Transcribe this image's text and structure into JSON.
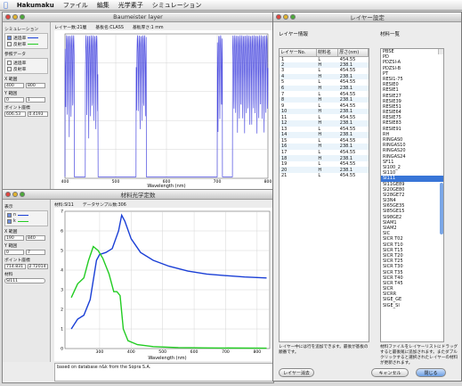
{
  "menubar": {
    "app": "Hakumaku",
    "items": [
      "ファイル",
      "編集",
      "光学素子",
      "シミュレーション"
    ]
  },
  "window1": {
    "title": "Baumeister layer",
    "info": [
      "レイヤー数:21層",
      "基板名:CLASS",
      "基板厚さ:1 mm"
    ],
    "side": {
      "sim_label": "シミュレーション",
      "sim_opts": [
        "透過率",
        "反射率"
      ],
      "ref_label": "参照データ",
      "ref_opts": [
        "透過率",
        "反射率"
      ],
      "x_label": "X 範囲",
      "x_vals": [
        "400",
        "800"
      ],
      "y_label": "Y 範囲",
      "y_vals": [
        "0",
        "1"
      ],
      "pt_label": "ポイント座標",
      "pt_vals": [
        "606.53",
        "0.4193"
      ]
    },
    "xlabel": "Wavelength (nm)",
    "xticks": [
      "400",
      "500",
      "600",
      "700",
      "800"
    ]
  },
  "window2": {
    "title": "材料光学定数",
    "info": [
      "材料:SI11",
      "データサンプル数:306"
    ],
    "side": {
      "disp_label": "表示",
      "disp_opts": [
        "n",
        "k"
      ],
      "x_label": "X 範囲",
      "x_vals": [
        "190",
        "840"
      ],
      "y_label": "Y 範囲",
      "y_vals": [
        "0",
        "7"
      ],
      "pt_label": "ポイント座標",
      "pt_vals": [
        "714.831",
        "2.72014"
      ],
      "mat_label": "材料",
      "mat_value": "SI111"
    },
    "xlabel": "Wavelength (nm)",
    "xticks": [
      "300",
      "400",
      "500",
      "600",
      "700",
      "800"
    ],
    "yticks": [
      "0",
      "1",
      "2",
      "3",
      "4",
      "5",
      "6",
      "7"
    ],
    "footer": "based on database n&k from the Sopra S.A."
  },
  "dialog": {
    "title": "レイヤー設定",
    "layer_info": "レイヤー情報",
    "materials_title": "材料一覧",
    "columns": [
      "レイヤーNo.",
      "材料名",
      "厚さ(nm)"
    ],
    "rows": [
      [
        "1",
        "L",
        "454.55"
      ],
      [
        "2",
        "H",
        "238.1"
      ],
      [
        "3",
        "L",
        "454.55"
      ],
      [
        "4",
        "H",
        "238.1"
      ],
      [
        "5",
        "L",
        "454.55"
      ],
      [
        "6",
        "H",
        "238.1"
      ],
      [
        "7",
        "L",
        "454.55"
      ],
      [
        "8",
        "H",
        "238.1"
      ],
      [
        "9",
        "L",
        "454.55"
      ],
      [
        "10",
        "H",
        "238.1"
      ],
      [
        "11",
        "L",
        "454.55"
      ],
      [
        "12",
        "H",
        "238.1"
      ],
      [
        "13",
        "L",
        "454.55"
      ],
      [
        "14",
        "H",
        "238.1"
      ],
      [
        "15",
        "L",
        "454.55"
      ],
      [
        "16",
        "H",
        "238.1"
      ],
      [
        "17",
        "L",
        "454.55"
      ],
      [
        "18",
        "H",
        "238.1"
      ],
      [
        "19",
        "L",
        "454.55"
      ],
      [
        "20",
        "H",
        "238.1"
      ],
      [
        "21",
        "L",
        "454.55"
      ]
    ],
    "materials": [
      "PBSE",
      "PD",
      "PDZSI-A",
      "PDZSI-B",
      "PT",
      "RESI1-75",
      "RESIE0",
      "RESIE1",
      "RESIE27",
      "RESIE39",
      "RESIE51",
      "RESIE64",
      "RESIE75",
      "RESIE83",
      "RESIE91",
      "RH",
      "RINGAS0",
      "RINGAS10",
      "RINGAS20",
      "RINGAS24",
      "SF11",
      "SI100_2",
      "SI110",
      "SI111",
      "SI11GE89",
      "SI20GE80",
      "SI28GE72",
      "SI3N4",
      "SI65GE35",
      "SI85GE15",
      "SI98GE2",
      "SIAM1",
      "SIAM2",
      "SIC",
      "SICR T02",
      "SICR T10",
      "SICR T15",
      "SICR T20",
      "SICR T25",
      "SICR T30",
      "SICR T35",
      "SICR T40",
      "SICR T45",
      "SICR",
      "SICRR",
      "SIGE_GE",
      "SIGE_SI"
    ],
    "selected_material": "SI111",
    "note_left": "レイヤー中には行を追加できます。最後が基板の順番です。",
    "note_right": "材料ファイルをレイヤーリストにドラッグすると最後尾に追加されます。またダブルクリックすると選択されたレイヤーの材料が更新されます。",
    "delete_button": "レイヤー消去",
    "cancel_button": "キャンセル",
    "close_button": "閉じる"
  },
  "colors": {
    "transmittance": "#4a4adf",
    "n_series": "#1a3fd6",
    "k_series": "#22cc22"
  }
}
